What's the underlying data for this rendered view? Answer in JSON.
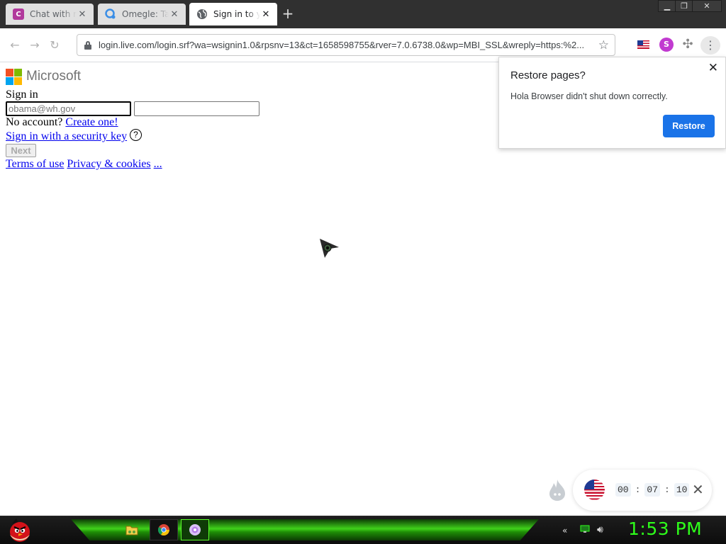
{
  "browser": {
    "tabs": [
      {
        "title": "Chat with r",
        "favicon": "c-icon",
        "favicon_letter": "C",
        "active": false
      },
      {
        "title": "Omegle: Ta",
        "favicon": "omegle-icon",
        "active": false
      },
      {
        "title": "Sign in to y",
        "favicon": "globe-icon",
        "active": true
      }
    ],
    "new_tab_label": "+",
    "url": "login.live.com/login.srf?wa=wsignin1.0&rpsnv=13&ct=1658598755&rver=7.0.6738.0&wp=MBI_SSL&wreply=https:%2...",
    "extensions": {
      "s_label": "S"
    }
  },
  "page": {
    "brand": "Microsoft",
    "logo_colors": [
      "#f25022",
      "#7fba00",
      "#00a4ef",
      "#ffb900"
    ],
    "signin_label": "Sign in",
    "email_value": "obama@wh.gov",
    "no_account_text": "No account?",
    "create_link": "Create one!",
    "security_key_link": "Sign in with a security key",
    "help_glyph": "?",
    "next_label": "Next",
    "footer": {
      "terms": "Terms of use",
      "privacy": "Privacy & cookies",
      "more": "..."
    }
  },
  "restore_popup": {
    "title": "Restore pages?",
    "message": "Hola Browser didn't shut down correctly.",
    "button_label": "Restore",
    "accent": "#1a73e8"
  },
  "hola_widget": {
    "hours": "00",
    "minutes": "07",
    "seconds": "10",
    "separator": ":"
  },
  "taskbar": {
    "clock": "1:53 PM",
    "accent": "#2eff1a"
  }
}
